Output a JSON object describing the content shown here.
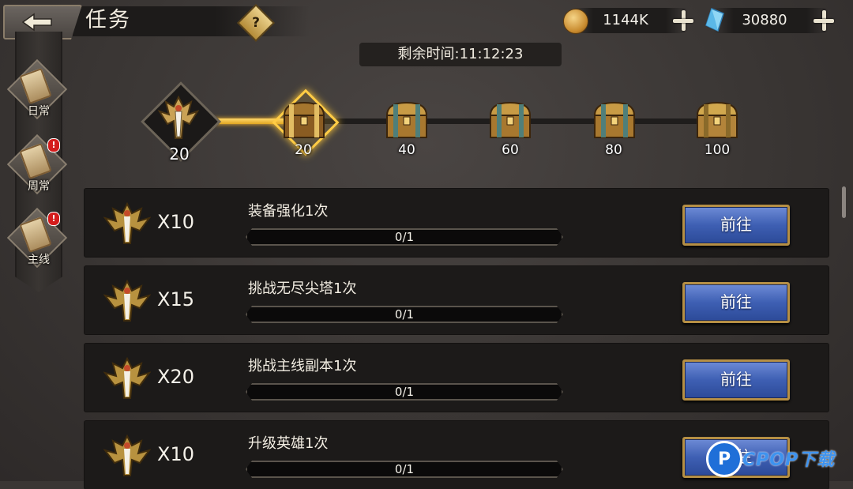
{
  "header": {
    "title": "任务",
    "help_label": "?",
    "gold": "1144K",
    "gems": "30880"
  },
  "sidebar": {
    "items": [
      {
        "label": "日常",
        "badge": ""
      },
      {
        "label": "周常",
        "badge": "!"
      },
      {
        "label": "主线",
        "badge": "!"
      }
    ]
  },
  "timer": {
    "text": "剩余时间:11:12:23"
  },
  "progress": {
    "current_points": "20",
    "milestones": [
      "20",
      "40",
      "60",
      "80",
      "100"
    ]
  },
  "tasks": [
    {
      "reward": "X10",
      "name": "装备强化1次",
      "progress_text": "0/1",
      "button": "前往"
    },
    {
      "reward": "X15",
      "name": "挑战无尽尖塔1次",
      "progress_text": "0/1",
      "button": "前往"
    },
    {
      "reward": "X20",
      "name": "挑战主线副本1次",
      "progress_text": "0/1",
      "button": "前往"
    },
    {
      "reward": "X10",
      "name": "升级英雄1次",
      "progress_text": "0/1",
      "button": "前往"
    }
  ],
  "watermark": {
    "text": "CPOP下载",
    "logo": "P"
  },
  "colors": {
    "accent_gold": "#e0a523",
    "button_blue": "#3e5fb3",
    "badge_red": "#d41c1c"
  },
  "icons": {
    "back": "back-arrow-icon",
    "coin": "gold-coin-icon",
    "gem": "blue-crystal-icon",
    "chest": "treasure-chest-icon",
    "emblem": "sword-crest-icon"
  }
}
